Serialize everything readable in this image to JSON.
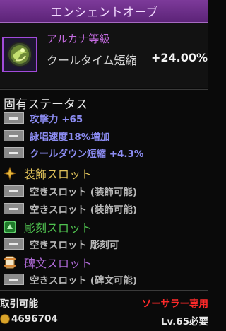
{
  "item": {
    "name": "エンシェントオーブ",
    "rarity": "アルカナ等級",
    "cooldown_label": "クールタイム短縮",
    "cooldown_value": "+24.00%"
  },
  "inherent": {
    "title": "固有ステータス",
    "stats": [
      "攻撃力 +65",
      "詠唱速度18%増加",
      "クールダウン短縮 +4.3%"
    ]
  },
  "accessory_slot": {
    "title": "装飾スロット",
    "entries": [
      "空きスロット (装飾可能)",
      "空きスロット (装飾可能)"
    ]
  },
  "engrave_slot": {
    "title": "彫刻スロット",
    "entries": [
      "空きスロット 彫刻可"
    ]
  },
  "inscription_slot": {
    "title": "碑文スロット",
    "entries": [
      "空きスロット (碑文可能)"
    ]
  },
  "footer": {
    "tradeable": "取引可能",
    "class_restriction": "ソーサラー専用",
    "price": "4696704",
    "level_requirement": "Lv.65必要"
  },
  "colors": {
    "title_bar": "#6a2c88",
    "rarity": "#c46be0",
    "stat_blue": "#8c8cf2",
    "accessory": "#e0c25a",
    "engrave": "#4fc24f",
    "inscription": "#b06ad8",
    "restriction_red": "#ff2a2a"
  }
}
